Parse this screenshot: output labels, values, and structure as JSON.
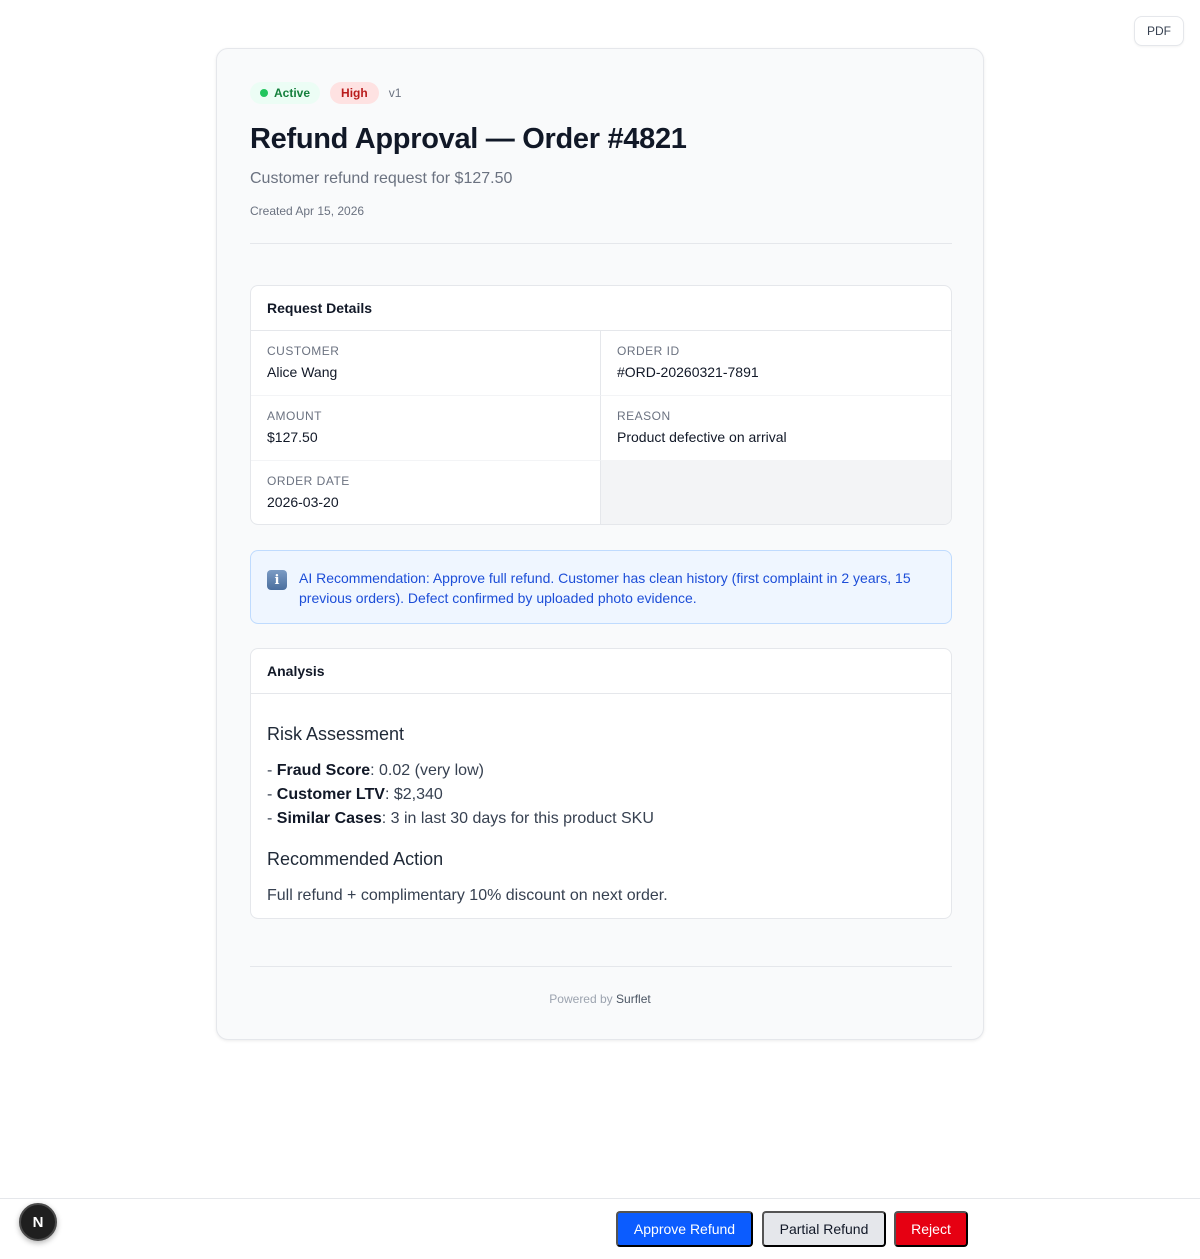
{
  "toolbar": {
    "pdf_label": "PDF"
  },
  "header": {
    "status": "Active",
    "priority": "High",
    "version": "v1",
    "title": "Refund Approval — Order #4821",
    "subtitle": "Customer refund request for $127.50",
    "created": "Created Apr 15, 2026"
  },
  "details": {
    "heading": "Request Details",
    "fields": [
      {
        "label": "Customer",
        "value": "Alice Wang"
      },
      {
        "label": "Order ID",
        "value": "#ORD-20260321-7891"
      },
      {
        "label": "Amount",
        "value": "$127.50"
      },
      {
        "label": "Reason",
        "value": "Product defective on arrival"
      },
      {
        "label": "Order Date",
        "value": "2026-03-20"
      }
    ]
  },
  "ai": {
    "icon": "info-icon",
    "text": "AI Recommendation: Approve full refund. Customer has clean history (first complaint in 2 years, 15 previous orders). Defect confirmed by uploaded photo evidence."
  },
  "analysis": {
    "heading": "Analysis",
    "risk_heading": "Risk Assessment",
    "items": [
      {
        "prefix": "- ",
        "key": "Fraud Score",
        "value": ": 0.02 (very low)"
      },
      {
        "prefix": "- ",
        "key": "Customer LTV",
        "value": ": $2,340"
      },
      {
        "prefix": "- ",
        "key": "Similar Cases",
        "value": ": 3 in last 30 days for this product SKU"
      }
    ],
    "action_heading": "Recommended Action",
    "action_text": "Full refund + complimentary 10% discount on next order."
  },
  "footer": {
    "powered_by": "Powered by",
    "brand": "Surflet",
    "dev_badge": "N"
  },
  "actions": {
    "approve": "Approve Refund",
    "partial": "Partial Refund",
    "reject": "Reject"
  },
  "colors": {
    "approve": "#0b5cff",
    "reject": "#e60012",
    "active": "#15803d",
    "high": "#b91c1c"
  }
}
